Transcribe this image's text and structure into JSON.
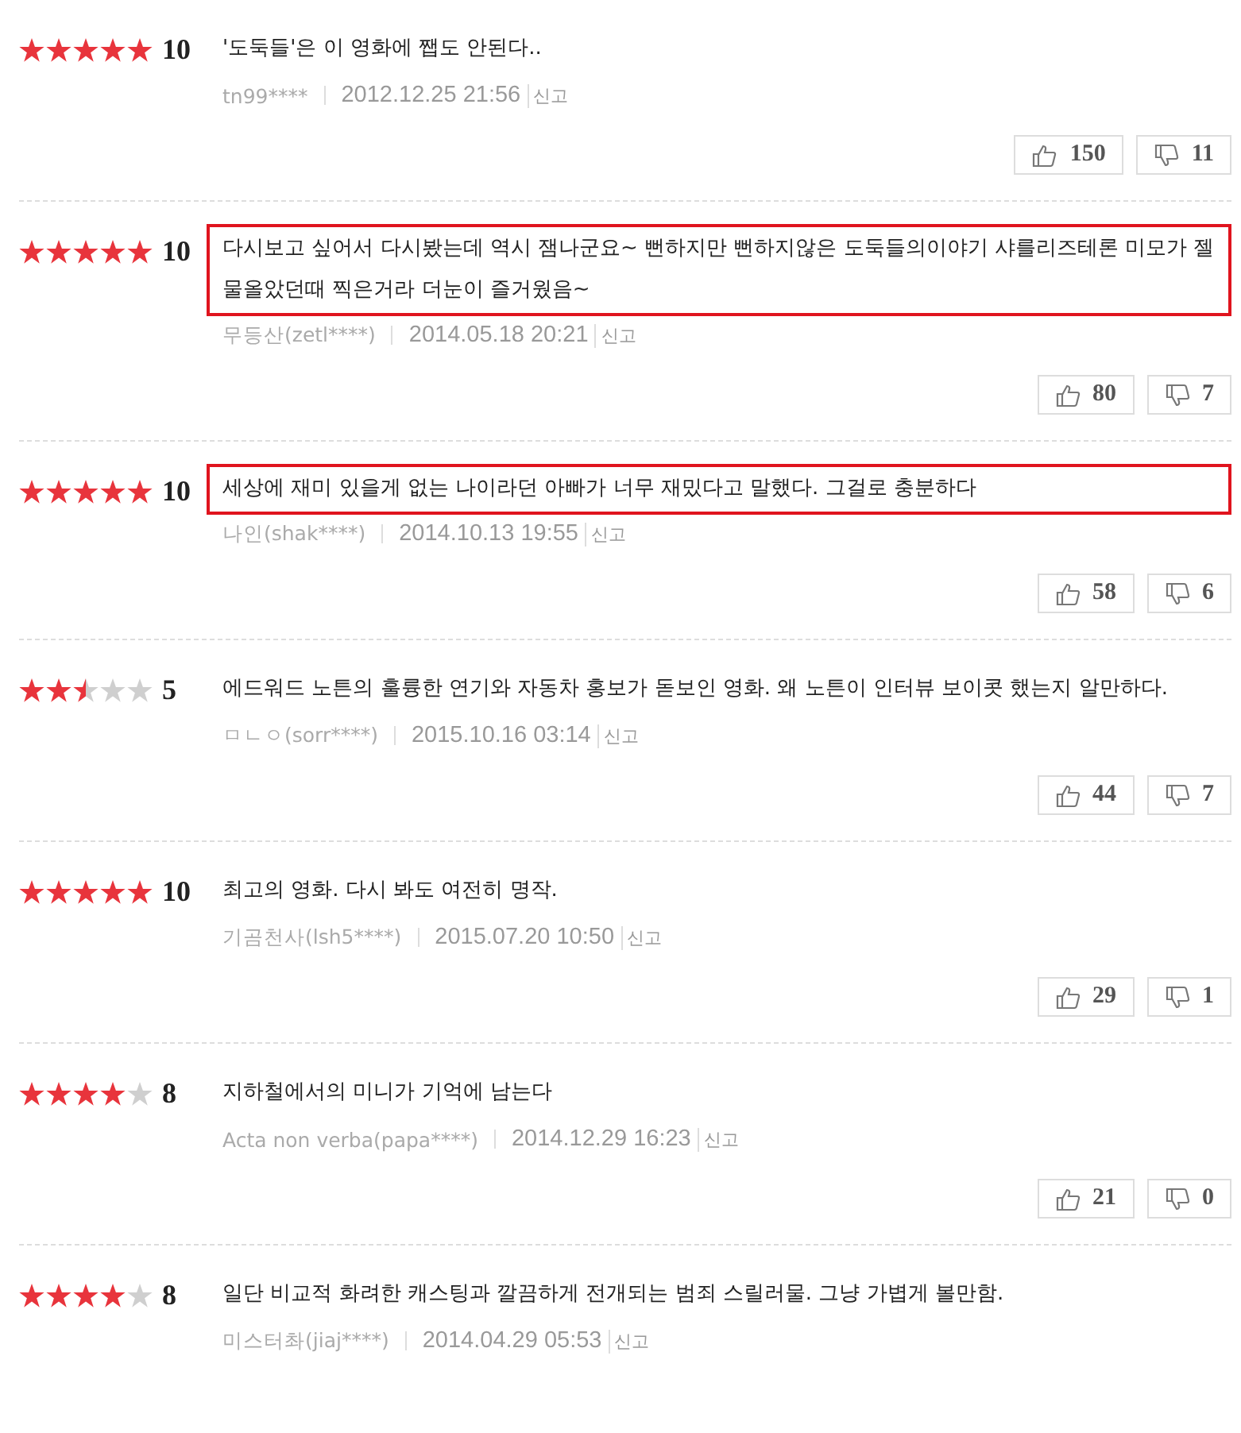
{
  "reviews": [
    {
      "stars": 5,
      "score": "10",
      "text": "'도둑들'은 이 영화에 쨉도 안된다..",
      "highlighted": false,
      "author": "tn99****",
      "date": "2012.12.25 21:56",
      "report": "신고",
      "likes": "150",
      "dislikes": "11"
    },
    {
      "stars": 5,
      "score": "10",
      "text": "다시보고 싶어서 다시봤는데 역시 잼나군요~ 뻔하지만 뻔하지않은 도둑들의이야기 샤를리즈테론 미모가 젤 물올았던때 찍은거라 더눈이 즐거웠음~",
      "highlighted": true,
      "author": "무등산(zetl****)",
      "date": "2014.05.18 20:21",
      "report": "신고",
      "likes": "80",
      "dislikes": "7"
    },
    {
      "stars": 5,
      "score": "10",
      "text": "세상에 재미 있을게 없는 나이라던 아빠가 너무 재밌다고 말했다. 그걸로 충분하다",
      "highlighted": true,
      "author": "나인(shak****)",
      "date": "2014.10.13 19:55",
      "report": "신고",
      "likes": "58",
      "dislikes": "6"
    },
    {
      "stars": 2.5,
      "score": "5",
      "text": "에드워드 노튼의 훌륭한 연기와 자동차 홍보가 돋보인 영화. 왜 노튼이 인터뷰 보이콧 했는지 알만하다.",
      "highlighted": false,
      "author": "ㅁㄴㅇ(sorr****)",
      "date": "2015.10.16 03:14",
      "report": "신고",
      "likes": "44",
      "dislikes": "7"
    },
    {
      "stars": 5,
      "score": "10",
      "text": "최고의 영화. 다시 봐도 여전히 명작.",
      "highlighted": false,
      "author": "기곰천사(lsh5****)",
      "date": "2015.07.20 10:50",
      "report": "신고",
      "likes": "29",
      "dislikes": "1"
    },
    {
      "stars": 4,
      "score": "8",
      "text": "지하철에서의 미니가 기억에 남는다",
      "highlighted": false,
      "author": "Acta non verba(papa****)",
      "date": "2014.12.29 16:23",
      "report": "신고",
      "likes": "21",
      "dislikes": "0"
    },
    {
      "stars": 4,
      "score": "8",
      "text": "일단 비교적 화려한 캐스팅과 깔끔하게 전개되는 범죄 스릴러물. 그냥 가볍게 볼만함.",
      "highlighted": false,
      "author": "미스터촤(jiaj****)",
      "date": "2014.04.29 05:53",
      "report": "신고"
    }
  ]
}
